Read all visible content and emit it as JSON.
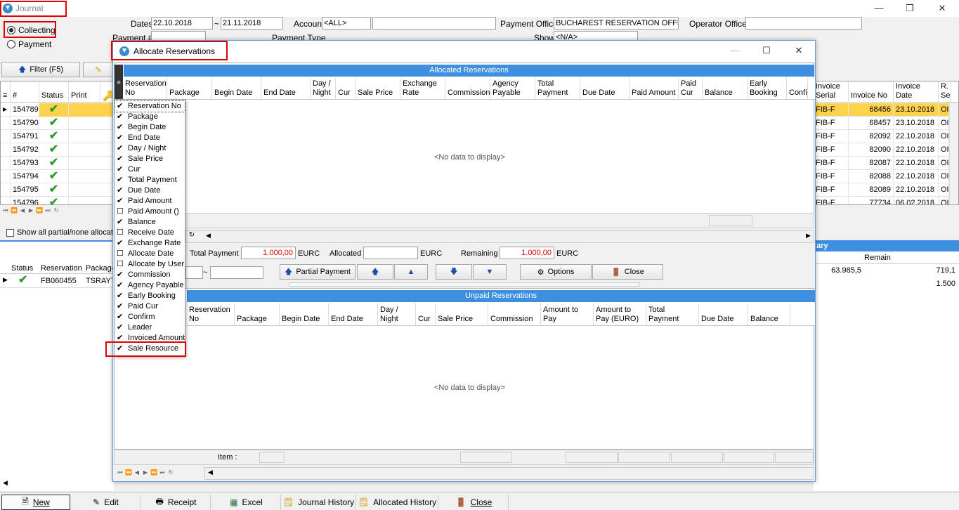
{
  "main_window": {
    "title": "Journal"
  },
  "options": {
    "collecting": "Collecting",
    "payment": "Payment"
  },
  "filters": {
    "dates_label": "Dates",
    "date_from": "22.10.2018",
    "tilde": "~",
    "date_to": "21.11.2018",
    "account_label": "Account",
    "account_value": "<ALL>",
    "payment_office_label": "Payment Office",
    "payment_office_value": "BUCHAREST RESERVATION OFFICE",
    "operator_office_label": "Operator Office",
    "payment_no_label": "Payment #",
    "payment_type_label": "Payment Type",
    "show_label": "Show",
    "show_value": "<N/A>"
  },
  "toolbar": {
    "filter": "Filter (F5)"
  },
  "main_grid": {
    "headers": [
      "#",
      "Status",
      "Print"
    ],
    "rows": [
      {
        "no": "154789"
      },
      {
        "no": "154790"
      },
      {
        "no": "154791"
      },
      {
        "no": "154792"
      },
      {
        "no": "154793"
      },
      {
        "no": "154794"
      },
      {
        "no": "154795"
      },
      {
        "no": "154796"
      }
    ],
    "right_headers": {
      "serial": "Invoice Serial",
      "invno": "Invoice No",
      "invdate": "Invoice Date",
      "rs": "R. Se"
    },
    "right_rows": [
      {
        "serial": "FIB-F",
        "no": "68456",
        "date": "23.10.2018",
        "x": "OI"
      },
      {
        "serial": "FIB-F",
        "no": "68457",
        "date": "23.10.2018",
        "x": "OI"
      },
      {
        "serial": "FIB-F",
        "no": "82092",
        "date": "22.10.2018",
        "x": "OI"
      },
      {
        "serial": "FIB-F",
        "no": "82090",
        "date": "22.10.2018",
        "x": "OI"
      },
      {
        "serial": "FIB-F",
        "no": "82087",
        "date": "22.10.2018",
        "x": "OI"
      },
      {
        "serial": "FIB-F",
        "no": "82088",
        "date": "22.10.2018",
        "x": "OI"
      },
      {
        "serial": "FIB-F",
        "no": "82089",
        "date": "22.10.2018",
        "x": "OI"
      },
      {
        "serial": "FIB-F",
        "no": "77734",
        "date": "06.02.2018",
        "x": "OI"
      }
    ]
  },
  "show_partial": "Show all partial/none allocate",
  "lower_grid": {
    "headers": [
      "Status",
      "Reservation",
      "Package"
    ],
    "row": {
      "reservation": "FB060455",
      "package": "TSRAYT"
    },
    "summary_title": "ary",
    "remain_label": "Remain",
    "val1": "63.985,5",
    "val2": "719,1",
    "val3": "1.500"
  },
  "dialog": {
    "title": "Allocate Reservations",
    "allocated_band": "Allocated Reservations",
    "unpaid_band": "Unpaid Reservations",
    "top_headers": [
      "Reservation No",
      "Package",
      "Begin Date",
      "End Date",
      "Day / Night",
      "Cur",
      "Sale Price",
      "Exchange Rate",
      "Commission",
      "Agency Payable",
      "Total Payment",
      "Due Date",
      "Paid Amount",
      "Paid Cur",
      "Balance",
      "Early Booking",
      "Confi"
    ],
    "no_data": "<No data to display>",
    "total_payment_label": "Total Payment",
    "total_payment": "1.000,00",
    "cur1": "EURC",
    "allocated_label": "Allocated",
    "cur2": "EURC",
    "remaining_label": "Remaining",
    "remaining": "1.000,00",
    "cur3": "EURC",
    "tilde": "~",
    "partial_payment": "Partial Payment",
    "options": "Options",
    "close": "Close",
    "bottom_headers": [
      "Reservation No",
      "Package",
      "Begin Date",
      "End Date",
      "Day / Night",
      "Cur",
      "Sale Price",
      "Commission",
      "Amount to Pay",
      "Amount to Pay (EURO)",
      "Total Payment",
      "Due Date",
      "Balance"
    ],
    "item_label": "Item :"
  },
  "column_menu": [
    {
      "label": "Reservation No",
      "checked": true
    },
    {
      "label": "Package",
      "checked": true
    },
    {
      "label": "Begin Date",
      "checked": true
    },
    {
      "label": "End Date",
      "checked": true
    },
    {
      "label": "Day / Night",
      "checked": true
    },
    {
      "label": "Sale Price",
      "checked": true
    },
    {
      "label": "Cur",
      "checked": true
    },
    {
      "label": "Total Payment",
      "checked": true
    },
    {
      "label": "Due Date",
      "checked": true
    },
    {
      "label": "Paid Amount",
      "checked": true
    },
    {
      "label": "Paid Amount ()",
      "checked": false
    },
    {
      "label": "Balance",
      "checked": true
    },
    {
      "label": "Receive Date",
      "checked": false
    },
    {
      "label": "Exchange Rate",
      "checked": true
    },
    {
      "label": "Allocate Date",
      "checked": false
    },
    {
      "label": "Allocate by User",
      "checked": false
    },
    {
      "label": "Commission",
      "checked": true
    },
    {
      "label": "Agency Payable",
      "checked": true
    },
    {
      "label": "Early Booking",
      "checked": true
    },
    {
      "label": "Paid Cur",
      "checked": true
    },
    {
      "label": "Confirm",
      "checked": true
    },
    {
      "label": "Leader",
      "checked": true
    },
    {
      "label": "Invoiced Amount",
      "checked": true
    },
    {
      "label": "Sale Resource",
      "checked": true
    }
  ],
  "bottom_bar": {
    "new": "New",
    "edit": "Edit",
    "receipt": "Receipt",
    "excel": "Excel",
    "journal_history": "Journal History",
    "allocated_history": "Allocated History",
    "close": "Close"
  },
  "colors": {
    "accent": "#3e8fe0",
    "highlight": "#ffd24d",
    "red": "#e00000"
  }
}
